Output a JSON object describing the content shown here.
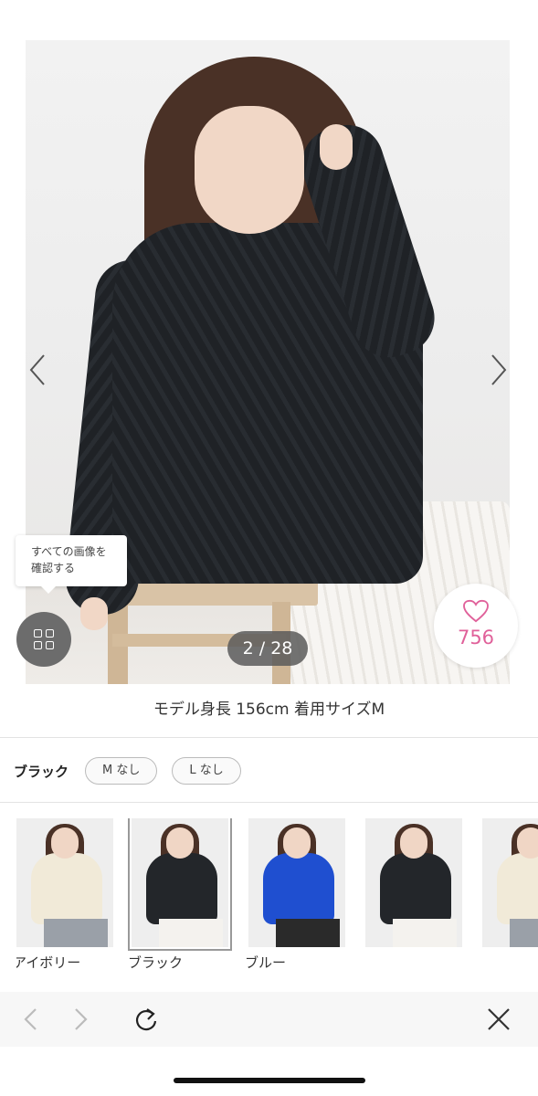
{
  "gallery": {
    "tooltip_line1": "すべての画像を",
    "tooltip_line2": "確認する",
    "counter": "2 / 28",
    "favorite_count": "756"
  },
  "model_info": "モデル身長 156cm 着用サイズM",
  "selection": {
    "color_name": "ブラック",
    "sizes": [
      "M なし",
      "L なし"
    ]
  },
  "colors": [
    {
      "label": "アイボリー",
      "swatch": "#f1ead8"
    },
    {
      "label": "ブラック",
      "swatch": "#23262a",
      "selected": true
    },
    {
      "label": "ブルー",
      "swatch": "#1f4fd0"
    },
    {
      "label": "",
      "swatch": "#23262a"
    },
    {
      "label": "",
      "swatch": "#f1ead8"
    }
  ],
  "accent_color": "#e0619a",
  "browser_toolbar": {
    "back_icon": "chevron-left-icon",
    "forward_icon": "chevron-right-icon",
    "reload_icon": "reload-icon",
    "close_icon": "close-icon"
  }
}
